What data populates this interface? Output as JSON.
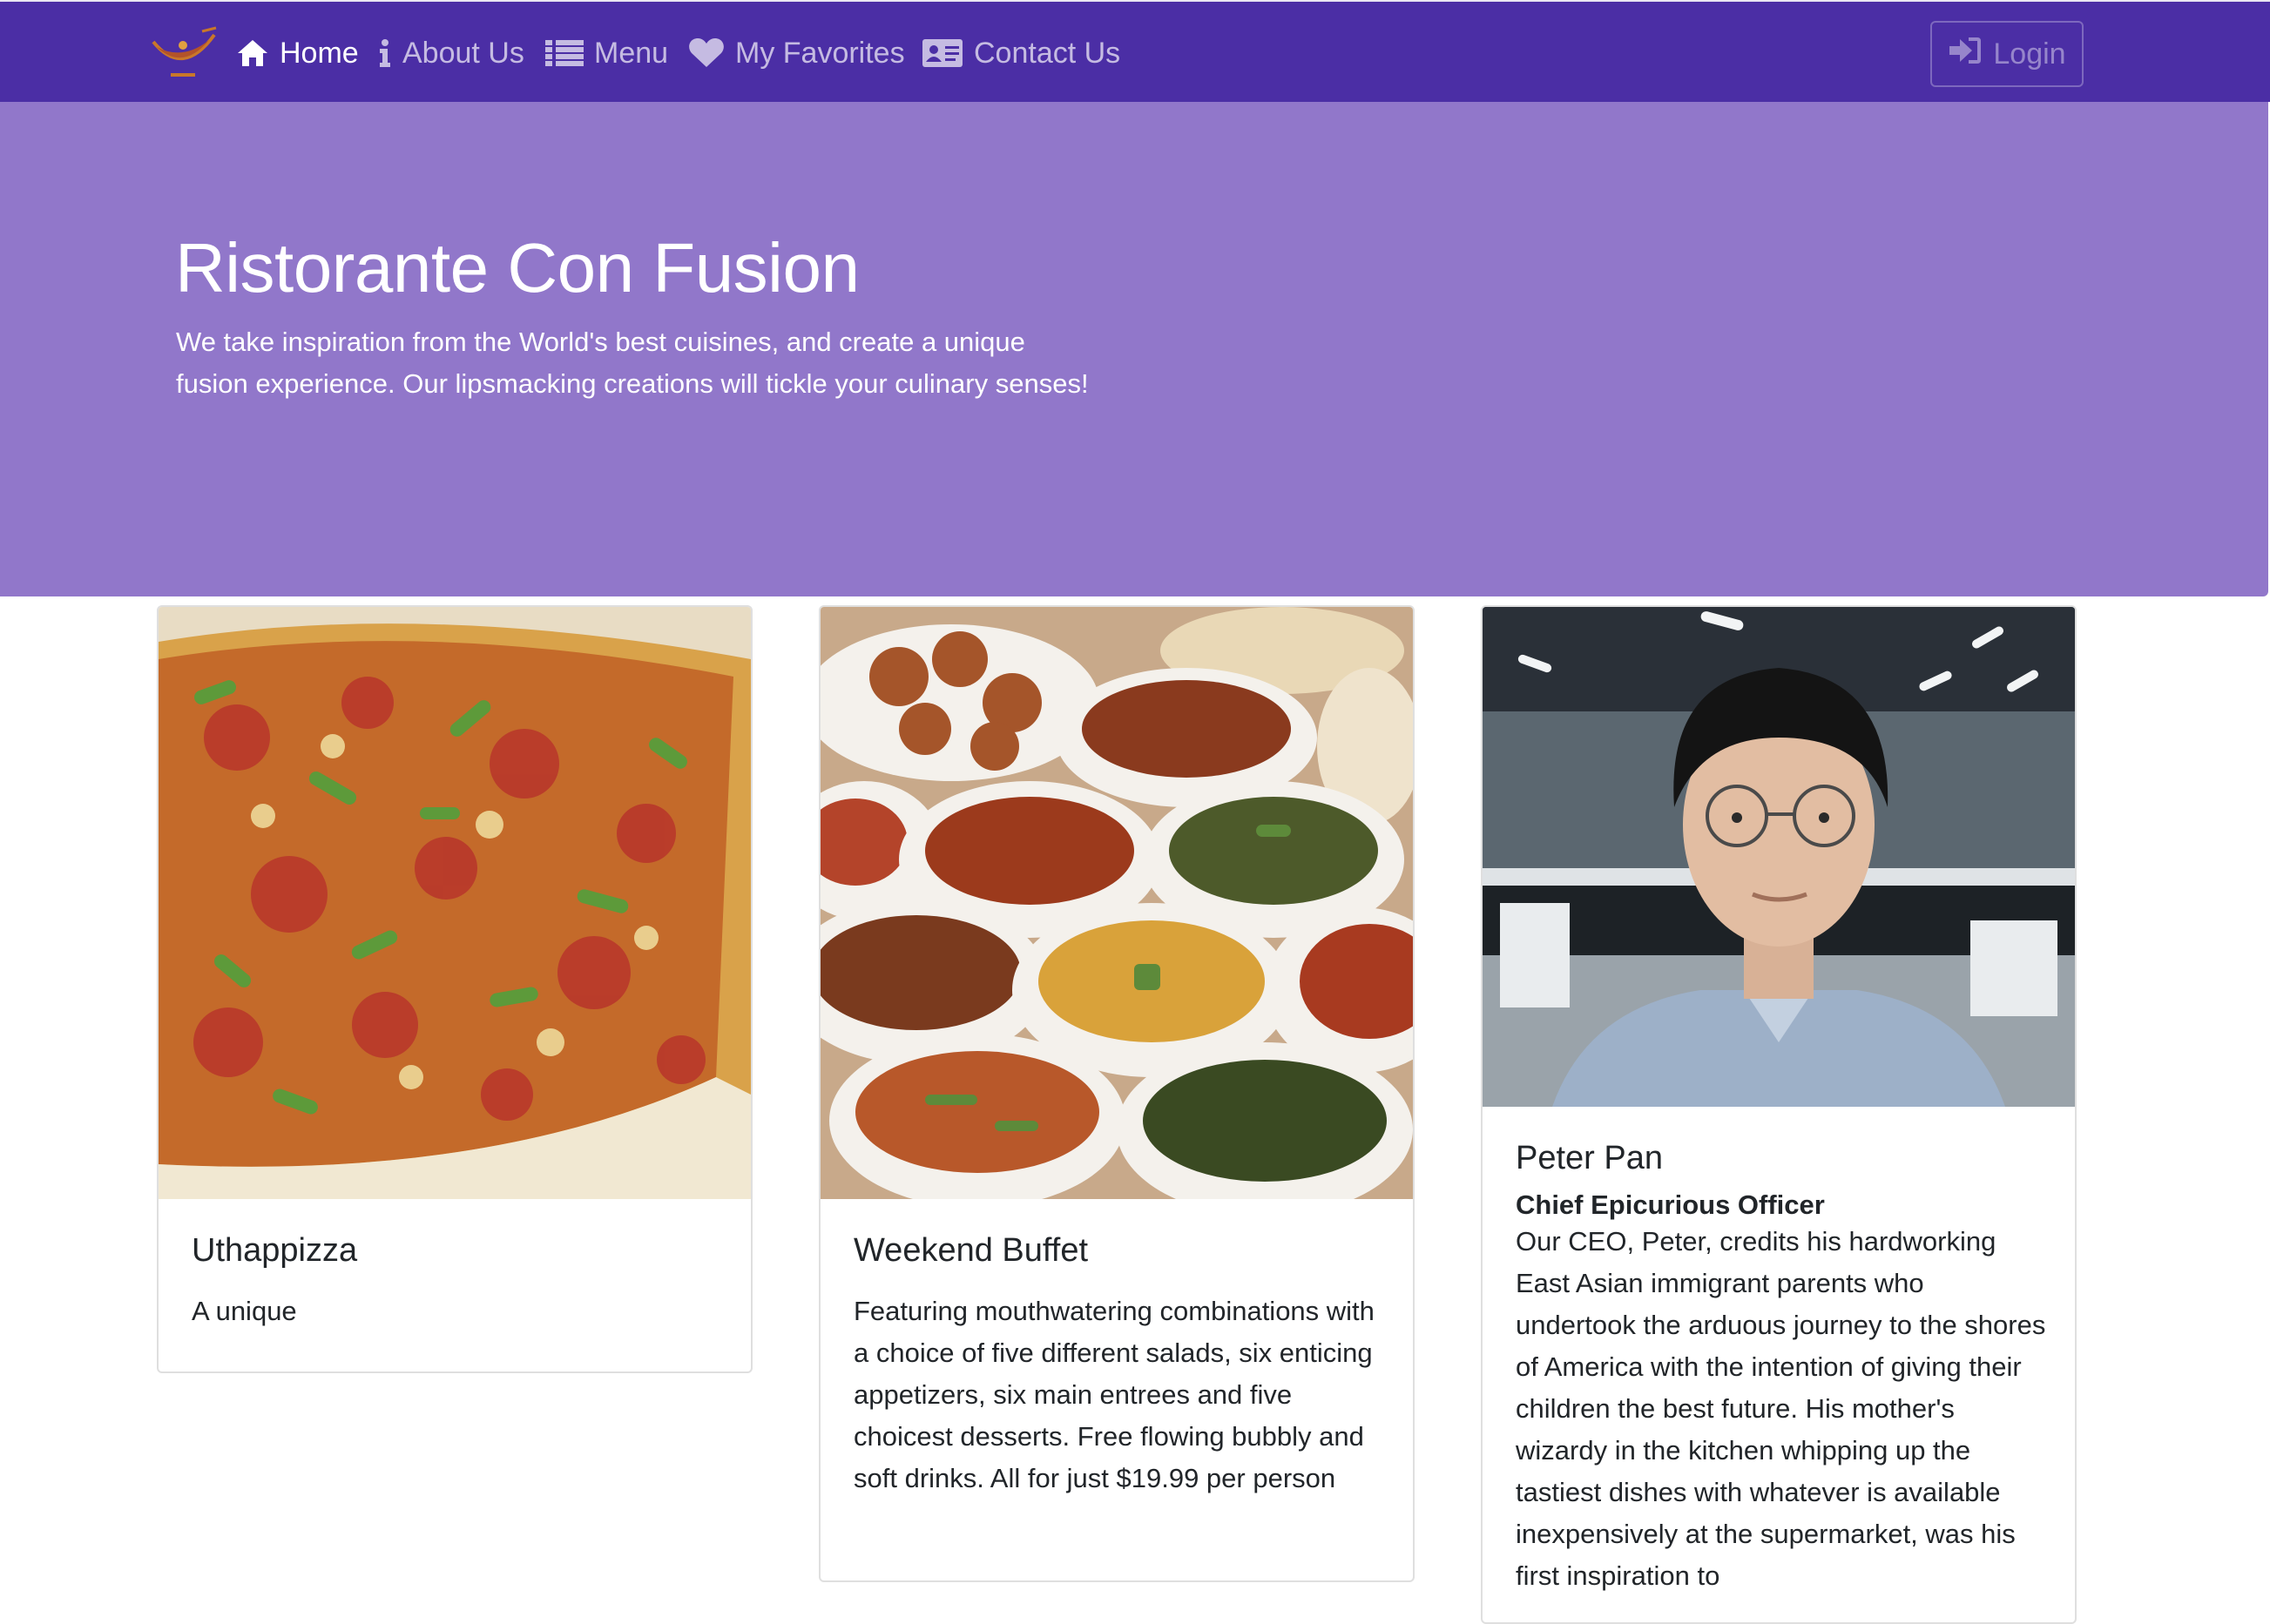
{
  "navbar": {
    "brand": "Ristorante Con Fusion logo",
    "items": [
      {
        "label": "Home",
        "icon": "home-icon",
        "active": true
      },
      {
        "label": "About Us",
        "icon": "info-icon",
        "active": false
      },
      {
        "label": "Menu",
        "icon": "list-icon",
        "active": false
      },
      {
        "label": "My Favorites",
        "icon": "heart-icon",
        "active": false
      },
      {
        "label": "Contact Us",
        "icon": "address-card-icon",
        "active": false
      }
    ],
    "login_label": "Login",
    "login_icon": "sign-in-icon"
  },
  "jumbotron": {
    "title": "Ristorante Con Fusion",
    "text": "We take inspiration from the World's best cuisines, and create a unique fusion experience. Our lipsmacking creations will tickle your culinary senses!"
  },
  "cards": [
    {
      "image": "uthappizza-photo",
      "title": "Uthappizza",
      "text": "A unique"
    },
    {
      "image": "weekend-buffet-photo",
      "title": "Weekend Buffet",
      "text": "Featuring mouthwatering combinations with a choice of five different salads, six enticing appetizers, six main entrees and five choicest desserts. Free flowing bubbly and soft drinks. All for just $19.99 per person"
    },
    {
      "image": "peter-pan-portrait",
      "title": "Peter Pan",
      "subtitle": "Chief Epicurious Officer",
      "text": "Our CEO, Peter, credits his hardworking East Asian immigrant parents who undertook the arduous journey to the shores of America with the intention of giving their children the best future. His mother's wizardy in the kitchen whipping up the tastiest dishes with whatever is available inexpensively at the supermarket, was his first inspiration to"
    }
  ],
  "colors": {
    "navbar": "#4b2ea5",
    "jumbotron": "#9177ca"
  }
}
